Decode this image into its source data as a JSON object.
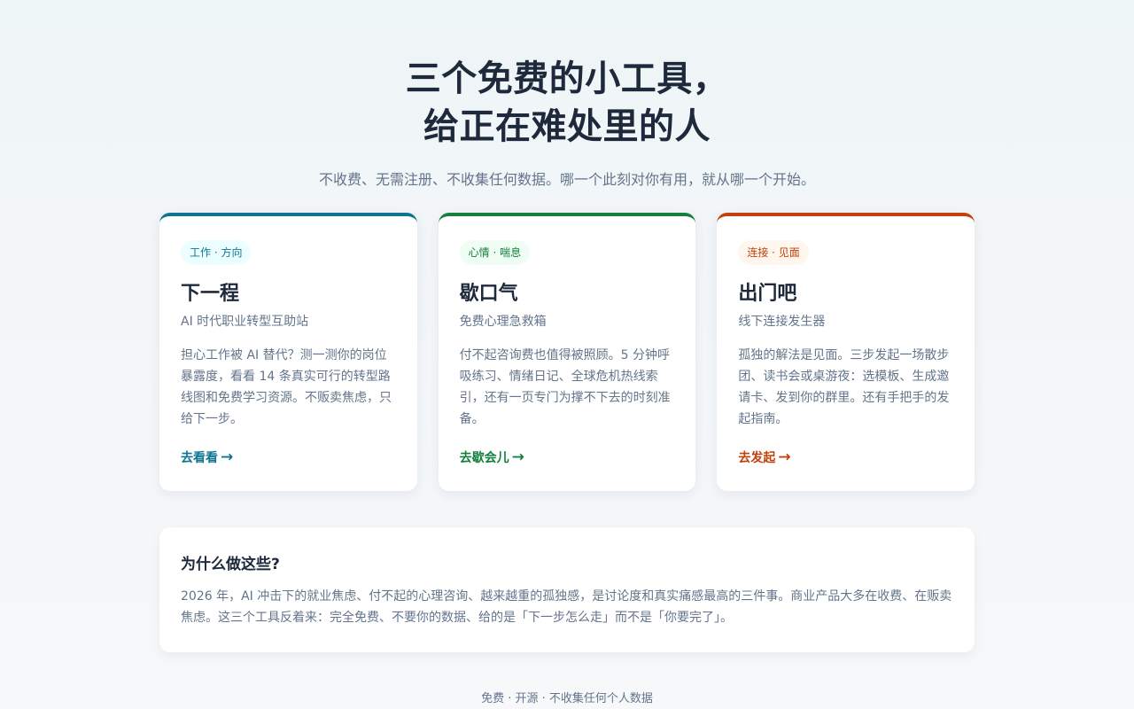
{
  "hero": {
    "title_line1": "三个免费的小工具，",
    "title_line2": "给正在难处里的人",
    "subtitle": "不收费、无需注册、不收集任何数据。哪一个此刻对你有用，就从哪一个开始。"
  },
  "cards": [
    {
      "tag": "工作 · 方向",
      "title": "下一程",
      "subtitle": "AI 时代职业转型互助站",
      "description": "担心工作被 AI 替代？测一测你的岗位暴露度，看看 14 条真实可行的转型路线图和免费学习资源。不贩卖焦虑，只给下一步。",
      "link": "去看看",
      "color": "#0e7490"
    },
    {
      "tag": "心情 · 喘息",
      "title": "歇口气",
      "subtitle": "免费心理急救箱",
      "description": "付不起咨询费也值得被照顾。5 分钟呼吸练习、情绪日记、全球危机热线索引，还有一页专门为撑不下去的时刻准备。",
      "link": "去歇会儿",
      "color": "#15803d"
    },
    {
      "tag": "连接 · 见面",
      "title": "出门吧",
      "subtitle": "线下连接发生器",
      "description": "孤独的解法是见面。三步发起一场散步团、读书会或桌游夜：选模板、生成邀请卡、发到你的群里。还有手把手的发起指南。",
      "link": "去发起",
      "color": "#c2410c"
    }
  ],
  "arrow": "→",
  "why": {
    "title": "为什么做这些?",
    "text": "2026 年，AI 冲击下的就业焦虑、付不起的心理咨询、越来越重的孤独感，是讨论度和真实痛感最高的三件事。商业产品大多在收费、在贩卖焦虑。这三个工具反着来：完全免费、不要你的数据、给的是「下一步怎么走」而不是「你要完了」。"
  },
  "footer": "免费 · 开源 · 不收集任何个人数据"
}
